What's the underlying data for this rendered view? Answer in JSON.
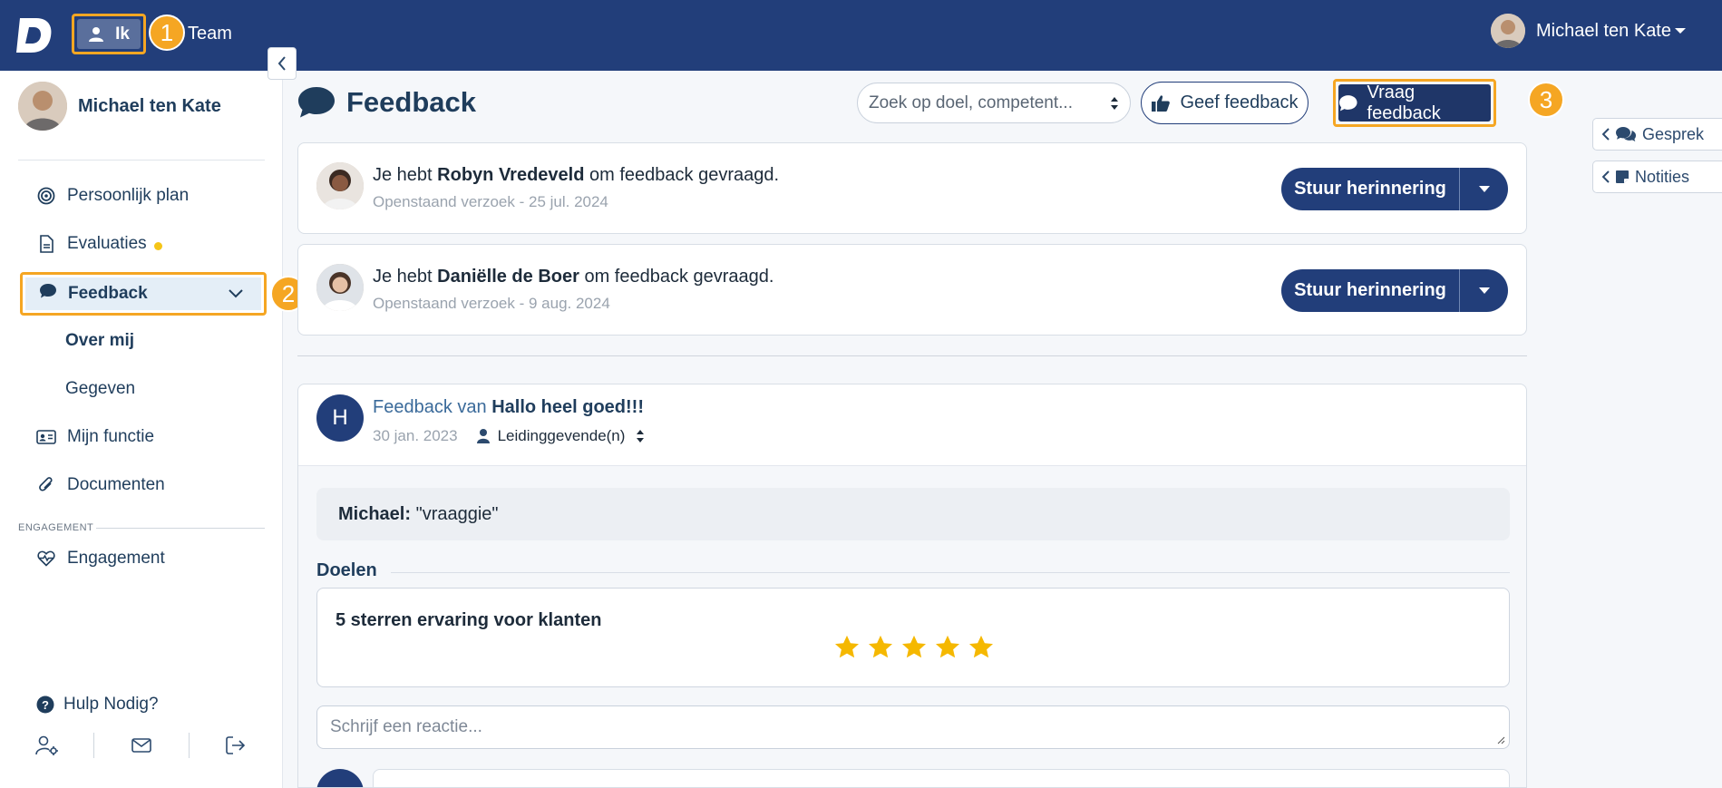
{
  "topbar": {
    "nav_me": "Ik",
    "nav_team": "Team",
    "user_name": "Michael ten Kate",
    "badges": [
      "1",
      "2",
      "3"
    ]
  },
  "sidebar": {
    "profile_name": "Michael ten Kate",
    "items": {
      "personal_plan": "Persoonlijk plan",
      "evaluations": "Evaluaties",
      "feedback": "Feedback",
      "about_me": "Over mij",
      "given": "Gegeven",
      "my_function": "Mijn functie",
      "documents": "Documenten",
      "engagement": "Engagement"
    },
    "section_engagement": "ENGAGEMENT",
    "help": "Hulp Nodig?"
  },
  "main": {
    "title": "Feedback",
    "search_placeholder": "Zoek op doel, competent...",
    "give_feedback": "Geef feedback",
    "ask_feedback": "Vraag feedback"
  },
  "right_tabs": {
    "conversation": "Gesprek",
    "notes": "Notities"
  },
  "requests": [
    {
      "prefix": "Je hebt ",
      "name": "Robyn Vredeveld",
      "suffix": " om feedback gevraagd.",
      "status": "Openstaand verzoek - 25 jul. 2024",
      "button": "Stuur herinnering"
    },
    {
      "prefix": "Je hebt ",
      "name": "Daniëlle de Boer",
      "suffix": " om feedback gevraagd.",
      "status": "Openstaand verzoek - 9 aug. 2024",
      "button": "Stuur herinnering"
    }
  ],
  "feedback_item": {
    "avatar_letter": "H",
    "title_prefix": "Feedback van ",
    "title_name": "Hallo heel goed!!!",
    "date": "30 jan. 2023",
    "role": "Leidinggevende(n)",
    "quote_author": "Michael:",
    "quote_text": "\"vraaggie\"",
    "goals_label": "Doelen",
    "goal_title": "5 sterren ervaring voor klanten",
    "rating": 5,
    "reply_placeholder": "Schrijf een reactie..."
  },
  "colors": {
    "navy": "#223e7a",
    "highlight": "#f5a623",
    "star": "#f5b800"
  }
}
